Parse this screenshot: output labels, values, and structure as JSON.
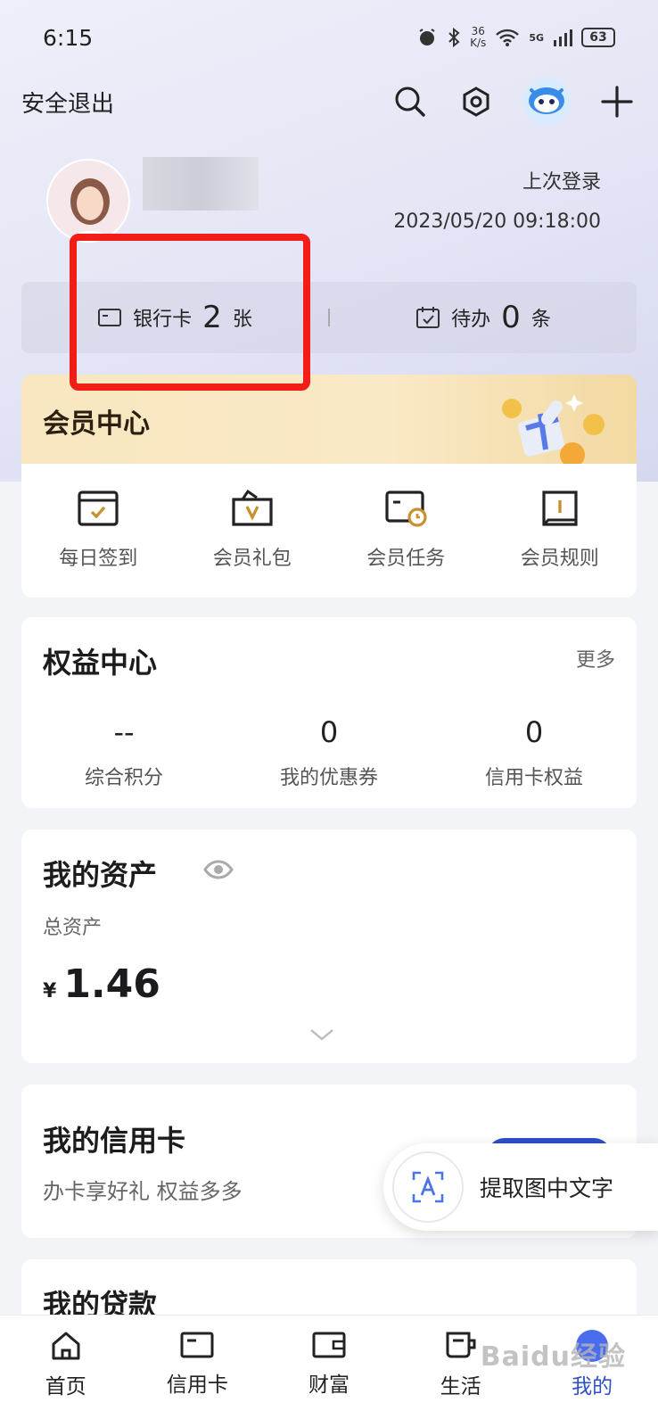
{
  "status_bar": {
    "time": "6:15",
    "net_speed_value": "36",
    "net_speed_unit": "K/s",
    "signal": "5G",
    "battery": "63"
  },
  "topbar": {
    "logout_label": "安全退出"
  },
  "profile": {
    "last_login_label": "上次登录",
    "last_login_time": "2023/05/20 09:18:00"
  },
  "summary": {
    "cards_label": "银行卡",
    "cards_count": "2",
    "cards_unit": "张",
    "todo_label": "待办",
    "todo_count": "0",
    "todo_unit": "条"
  },
  "member": {
    "title": "会员中心",
    "items": [
      {
        "label": "每日签到",
        "icon": "calendar-check-icon"
      },
      {
        "label": "会员礼包",
        "icon": "gift-bag-icon"
      },
      {
        "label": "会员任务",
        "icon": "task-clock-icon"
      },
      {
        "label": "会员规则",
        "icon": "rulebook-icon"
      }
    ]
  },
  "rights": {
    "title": "权益中心",
    "more_label": "更多",
    "items": [
      {
        "value": "--",
        "label": "综合积分"
      },
      {
        "value": "0",
        "label": "我的优惠券"
      },
      {
        "value": "0",
        "label": "信用卡权益"
      }
    ]
  },
  "assets": {
    "title": "我的资产",
    "total_label": "总资产",
    "currency": "¥",
    "total_value": "1.46"
  },
  "credit": {
    "title": "我的信用卡",
    "subtitle": "办卡享好礼 权益多多"
  },
  "extract": {
    "label": "提取图中文字"
  },
  "loans": {
    "title": "我的贷款"
  },
  "tabs": [
    {
      "label": "首页",
      "icon": "home-icon"
    },
    {
      "label": "信用卡",
      "icon": "credit-card-icon"
    },
    {
      "label": "财富",
      "icon": "wallet-icon"
    },
    {
      "label": "生活",
      "icon": "cup-icon"
    },
    {
      "label": "我的",
      "icon": "profile-icon"
    }
  ],
  "watermark": "Baidu经验",
  "colors": {
    "accent": "#2f4fc6",
    "highlight_box": "#f31d18",
    "member_banner": "#f8e7c0"
  }
}
